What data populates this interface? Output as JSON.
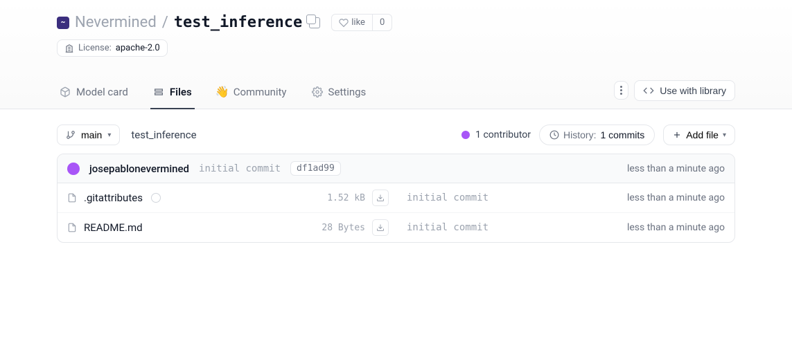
{
  "breadcrumb": {
    "org": "Nevermined",
    "sep": "/",
    "repo": "test_inference"
  },
  "like": {
    "label": "like",
    "count": "0"
  },
  "license": {
    "label": "License:",
    "value": "apache-2.0"
  },
  "tabs": {
    "model_card": "Model card",
    "files": "Files",
    "community": "Community",
    "settings": "Settings"
  },
  "actions": {
    "use_with_library": "Use with library"
  },
  "branch": {
    "name": "main"
  },
  "path": "test_inference",
  "contributors": {
    "text": "1 contributor"
  },
  "history": {
    "label": "History:",
    "value": "1 commits"
  },
  "add_file": "Add file",
  "last_commit": {
    "author": "josepablonevermined",
    "message": "initial commit",
    "sha": "df1ad99",
    "time": "less than a minute ago"
  },
  "files": [
    {
      "name": ".gitattributes",
      "has_badge": true,
      "size": "1.52 kB",
      "message": "initial commit",
      "time": "less than a minute ago"
    },
    {
      "name": "README.md",
      "has_badge": false,
      "size": "28 Bytes",
      "message": "initial commit",
      "time": "less than a minute ago"
    }
  ],
  "colors": {
    "accent": "#a855f7"
  }
}
